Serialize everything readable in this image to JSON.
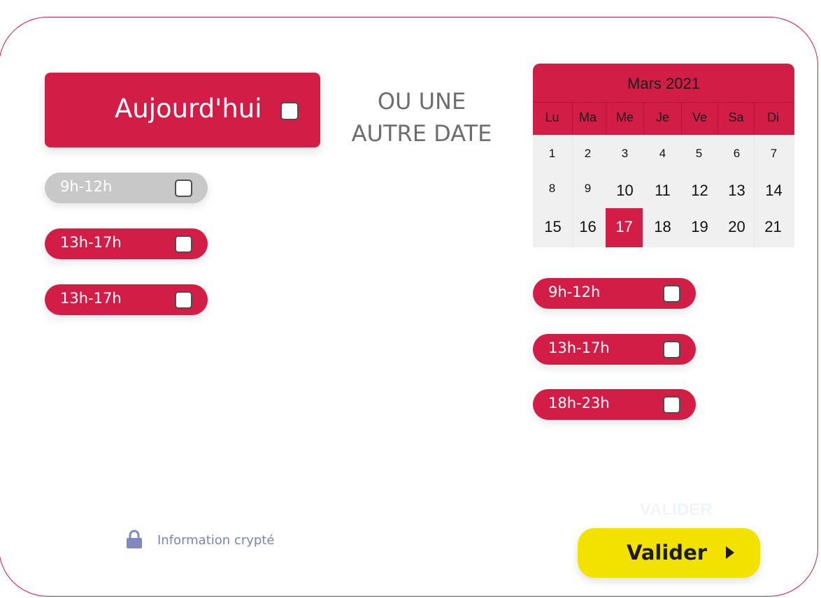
{
  "today": {
    "label": "Aujourd'hui"
  },
  "or_text": {
    "line1": "OU UNE",
    "line2": "AUTRE DATE"
  },
  "today_slots": [
    {
      "label": "9h-12h",
      "state": "disabled"
    },
    {
      "label": "13h-17h",
      "state": "active"
    },
    {
      "label": "13h-17h",
      "state": "active"
    }
  ],
  "calendar": {
    "title": "Mars 2021",
    "weekdays": [
      "Lu",
      "Ma",
      "Me",
      "Je",
      "Ve",
      "Sa",
      "Di"
    ],
    "weeks": [
      [
        "1",
        "2",
        "3",
        "4",
        "5",
        "6",
        "7"
      ],
      [
        "8",
        "9",
        "10",
        "11",
        "12",
        "13",
        "14"
      ],
      [
        "15",
        "16",
        "17",
        "18",
        "19",
        "20",
        "21"
      ]
    ],
    "selected_day": "17"
  },
  "date_slots": [
    {
      "label": "9h-12h",
      "state": "active"
    },
    {
      "label": "13h-17h",
      "state": "active"
    },
    {
      "label": "18h-23h",
      "state": "active"
    }
  ],
  "submit": {
    "ghost_label": "VALIDER",
    "label": "Valider"
  },
  "secure": {
    "label": "Information crypté"
  },
  "colors": {
    "accent": "#d21d47",
    "disabled": "#c8c8c8",
    "submit": "#f3e100",
    "secure_text": "#7b82b7"
  },
  "icons": {
    "lock": "lock-icon",
    "submit": "play-icon"
  }
}
